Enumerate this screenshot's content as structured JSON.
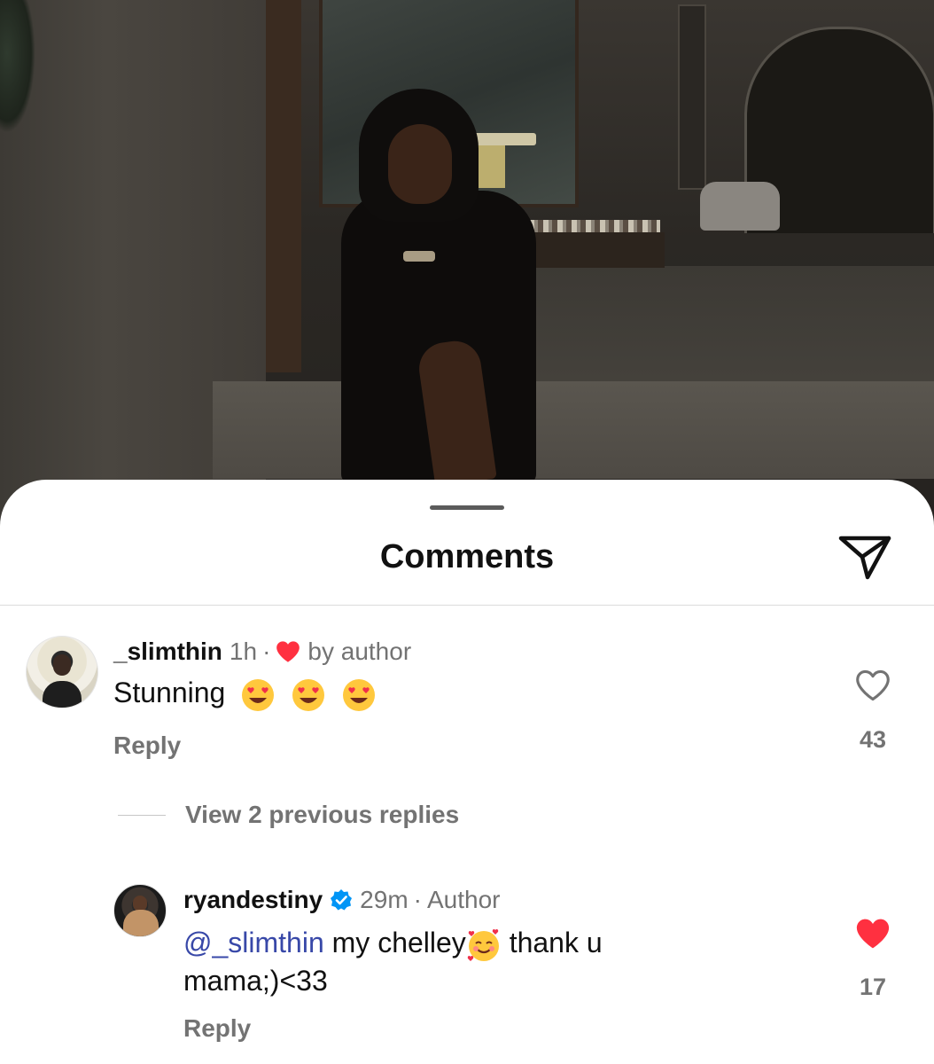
{
  "header": {
    "title": "Comments"
  },
  "comments": [
    {
      "username": "_slimthin",
      "time": "1h",
      "separator": "·",
      "author_like": "by author",
      "text": "Stunning",
      "emojis": [
        "heart-eyes",
        "heart-eyes",
        "heart-eyes"
      ],
      "reply_label": "Reply",
      "likes": "43",
      "liked": false,
      "view_replies": "View 2 previous replies"
    }
  ],
  "replies": [
    {
      "username": "ryandestiny",
      "verified": true,
      "time": "29m",
      "separator": "·",
      "badge": "Author",
      "mention": "@_slimthin",
      "text_before_emoji": " my chelley",
      "emoji": "smiling-face-with-hearts",
      "text_after_emoji": " thank u",
      "text_line2": "mama;)<33",
      "reply_label": "Reply",
      "likes": "17",
      "liked": true
    }
  ],
  "colors": {
    "like_red": "#ff3040",
    "verified_blue": "#0095f6",
    "mention_blue": "#3848a8",
    "muted": "#737373"
  }
}
